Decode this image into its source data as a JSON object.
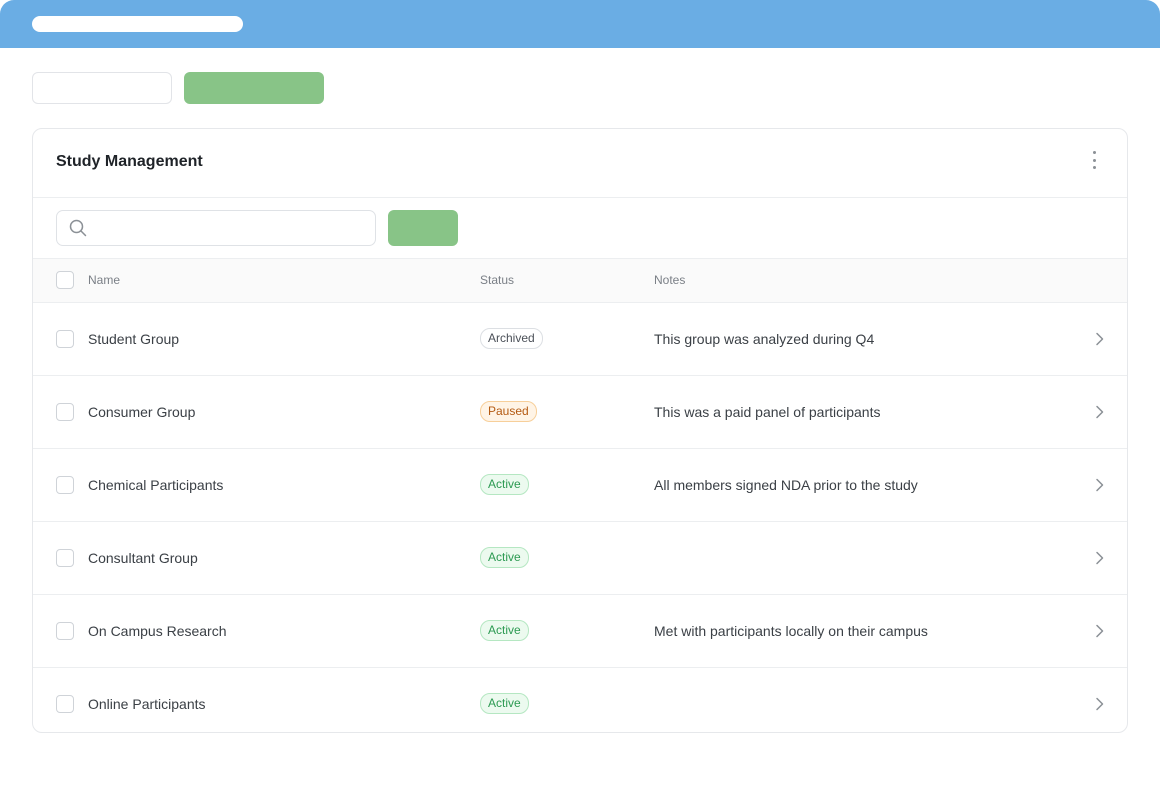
{
  "card": {
    "title": "Study Management"
  },
  "search": {
    "placeholder": "",
    "value": ""
  },
  "table": {
    "columns": [
      "Name",
      "Status",
      "Notes"
    ],
    "rows": [
      {
        "name": "Student Group",
        "status": "Archived",
        "notes": "This group was analyzed during Q4"
      },
      {
        "name": "Consumer Group",
        "status": "Paused",
        "notes": "This was a paid panel of participants"
      },
      {
        "name": "Chemical Participants",
        "status": "Active",
        "notes": "All members signed NDA prior to the study"
      },
      {
        "name": "Consultant Group",
        "status": "Active",
        "notes": ""
      },
      {
        "name": "On Campus Research",
        "status": "Active",
        "notes": "Met with participants locally on their campus"
      },
      {
        "name": "Online Participants",
        "status": "Active",
        "notes": ""
      }
    ]
  },
  "colors": {
    "topbar": "#6aade4",
    "accent_green": "#88c487",
    "status_archived": "#4b5058",
    "status_paused": "#b45a12",
    "status_active": "#2c9a52"
  },
  "icons": {
    "search": "search-icon",
    "more": "more-vertical-icon",
    "row_chevron": "chevron-right-icon"
  }
}
